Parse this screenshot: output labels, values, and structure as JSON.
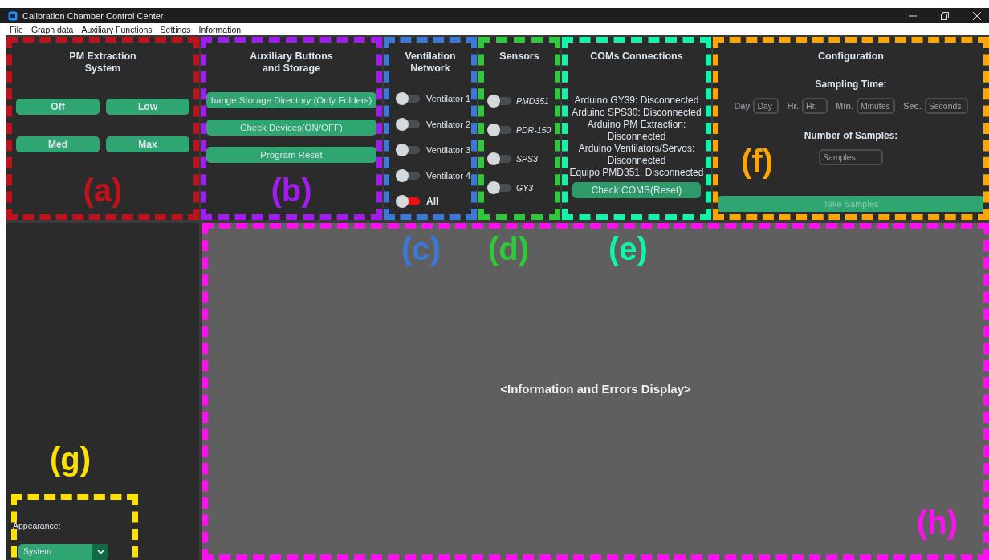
{
  "window": {
    "title": "Calibration Chamber Control Center"
  },
  "menu": [
    "File",
    "Graph data",
    "Auxiliary Functions",
    "Settings",
    "Information"
  ],
  "pm_extraction": {
    "title": "PM Extraction\nSystem",
    "buttons": [
      "Off",
      "Low",
      "Med",
      "Max"
    ],
    "annotation": {
      "label": "(a)",
      "color": "#c0121a"
    }
  },
  "auxiliary": {
    "title": "Auxiliary Buttons\nand Storage",
    "buttons": [
      "hange Storage Directory (Only Folders)",
      "Check Devices(ON/OFF)",
      "Program Reset"
    ],
    "annotation": {
      "label": "(b)",
      "color": "#a21cf0"
    }
  },
  "ventilation": {
    "title": "Ventilation\nNetwork",
    "switches": [
      {
        "label": "Ventilator 1",
        "on": false,
        "kind": "single"
      },
      {
        "label": "Ventilator 2",
        "on": false,
        "kind": "single"
      },
      {
        "label": "Ventilator 3",
        "on": false,
        "kind": "single"
      },
      {
        "label": "Ventilator 4",
        "on": false,
        "kind": "single"
      },
      {
        "label": "All",
        "on": true,
        "kind": "master"
      }
    ],
    "annotation": {
      "label": "(c)",
      "color": "#3a7ad6"
    }
  },
  "sensors": {
    "title": "Sensors",
    "switches": [
      {
        "label": "PMD351",
        "on": false
      },
      {
        "label": "PDR-150",
        "on": false
      },
      {
        "label": "SPS3",
        "on": false
      },
      {
        "label": "GY3",
        "on": false
      }
    ],
    "annotation": {
      "label": "(d)",
      "color": "#2ec83a"
    }
  },
  "coms": {
    "title": "COMs Connections",
    "statuses": [
      "Arduino GY39: Disconnected",
      "Arduino SPS30: Disconnected",
      "Arduino PM Extraction: Disconnected",
      "Arduino Ventilators/Servos: Disconnected",
      "Equipo PMD351: Disconnected"
    ],
    "button": "Check COMS(Reset)",
    "annotation": {
      "label": "(e)",
      "color": "#10f5aa"
    }
  },
  "configuration": {
    "title": "Configuration",
    "sampling_label": "Sampling Time:",
    "time_fields": [
      {
        "label": "Day",
        "placeholder": "Day"
      },
      {
        "label": "Hr.",
        "placeholder": "Hr."
      },
      {
        "label": "Min.",
        "placeholder": "Minutes"
      },
      {
        "label": "Sec.",
        "placeholder": "Seconds"
      }
    ],
    "samples_label": "Number of Samples:",
    "samples_field": {
      "placeholder": "Samples"
    },
    "take_button": {
      "label": "Take Samples",
      "disabled": true
    },
    "annotation": {
      "label": "(f)",
      "color": "#ffa500"
    }
  },
  "sidebar": {
    "appearance_label": "Appearance:",
    "appearance_value": "System",
    "annotation": {
      "label": "(g)",
      "color": "#ffe100"
    }
  },
  "display": {
    "text": "<Information and Errors Display>",
    "annotation": {
      "label": "(h)",
      "color": "#ff10f0"
    }
  }
}
